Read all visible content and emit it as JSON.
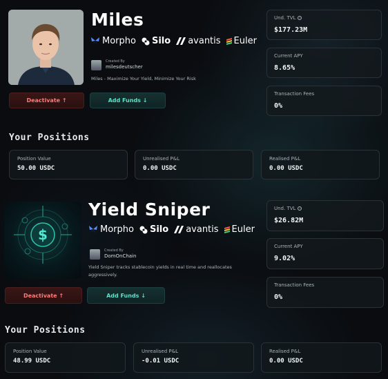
{
  "vaults": [
    {
      "name": "Miles",
      "protocols": [
        "Morpho",
        "Silo",
        "avantis",
        "Euler"
      ],
      "created_by_label": "Created By",
      "creator": "milesdeutscher",
      "description": "Miles - Maximize Your Yield, Minimize Your Risk",
      "deactivate_label": "Deactivate ↑",
      "add_funds_label": "Add Funds ↓",
      "stats": [
        {
          "label": "Und. TVL",
          "value": "$177.23M",
          "info": true
        },
        {
          "label": "Current APY",
          "value": "8.65%",
          "info": false
        },
        {
          "label": "Transaction Fees",
          "value": "0%",
          "info": false
        }
      ],
      "positions_title": "Your Positions",
      "positions": [
        {
          "label": "Position Value",
          "value": "50.00 USDC"
        },
        {
          "label": "Unrealised P&L",
          "value": "0.00 USDC"
        },
        {
          "label": "Realised P&L",
          "value": "0.00 USDC"
        }
      ]
    },
    {
      "name": "Yield Sniper",
      "protocols": [
        "Morpho",
        "Silo",
        "avantis",
        "Euler"
      ],
      "created_by_label": "Created By",
      "creator": "DomOnChain",
      "description": "Yield Sniper tracks stablecoin yields in real time and reallocates aggressively.",
      "deactivate_label": "Deactivate ↑",
      "add_funds_label": "Add Funds ↓",
      "stats": [
        {
          "label": "Und. TVL",
          "value": "$26.82M",
          "info": true
        },
        {
          "label": "Current APY",
          "value": "9.02%",
          "info": false
        },
        {
          "label": "Transaction Fees",
          "value": "0%",
          "info": false
        }
      ],
      "positions_title": "Your Positions",
      "positions": [
        {
          "label": "Position Value",
          "value": "48.99 USDC"
        },
        {
          "label": "Unrealised P&L",
          "value": "-0.01 USDC"
        },
        {
          "label": "Realised P&L",
          "value": "0.00 USDC"
        }
      ]
    }
  ],
  "colors": {
    "deactivate": "#ff7a7a",
    "add_funds": "#5fe0c8",
    "morpho_blue": "#5b8cff",
    "euler_green": "#47d47a"
  },
  "icons": {
    "morpho": "butterfly-icon",
    "silo": "silo-icon",
    "avantis": "avantis-icon",
    "euler": "euler-icon",
    "info": "info-icon",
    "vault2_avatar": "dollar-target-icon"
  }
}
